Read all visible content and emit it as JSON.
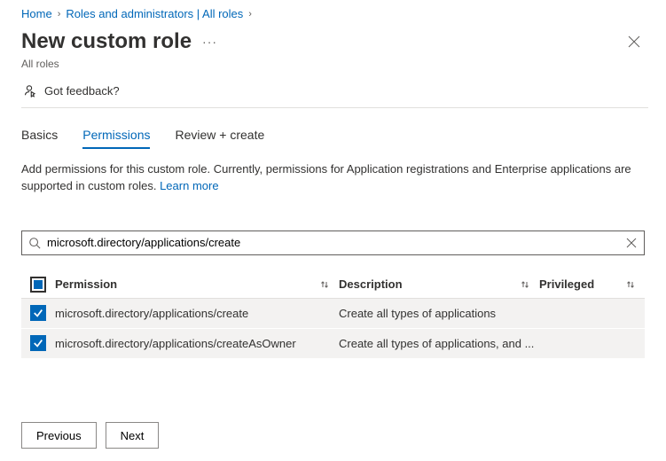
{
  "breadcrumb": {
    "home": "Home",
    "section": "Roles and administrators | All roles"
  },
  "header": {
    "title": "New custom role",
    "subtitle": "All roles"
  },
  "feedback": {
    "label": "Got feedback?"
  },
  "tabs": {
    "basics": "Basics",
    "permissions": "Permissions",
    "review": "Review + create"
  },
  "description": {
    "text": "Add permissions for this custom role. Currently, permissions for Application registrations and Enterprise applications are supported in custom roles. ",
    "learn_more": "Learn more"
  },
  "search": {
    "value": "microsoft.directory/applications/create"
  },
  "table": {
    "headers": {
      "permission": "Permission",
      "description": "Description",
      "privileged": "Privileged"
    },
    "rows": [
      {
        "permission": "microsoft.directory/applications/create",
        "description": "Create all types of applications"
      },
      {
        "permission": "microsoft.directory/applications/createAsOwner",
        "description": "Create all types of applications, and ..."
      }
    ]
  },
  "footer": {
    "previous": "Previous",
    "next": "Next"
  }
}
